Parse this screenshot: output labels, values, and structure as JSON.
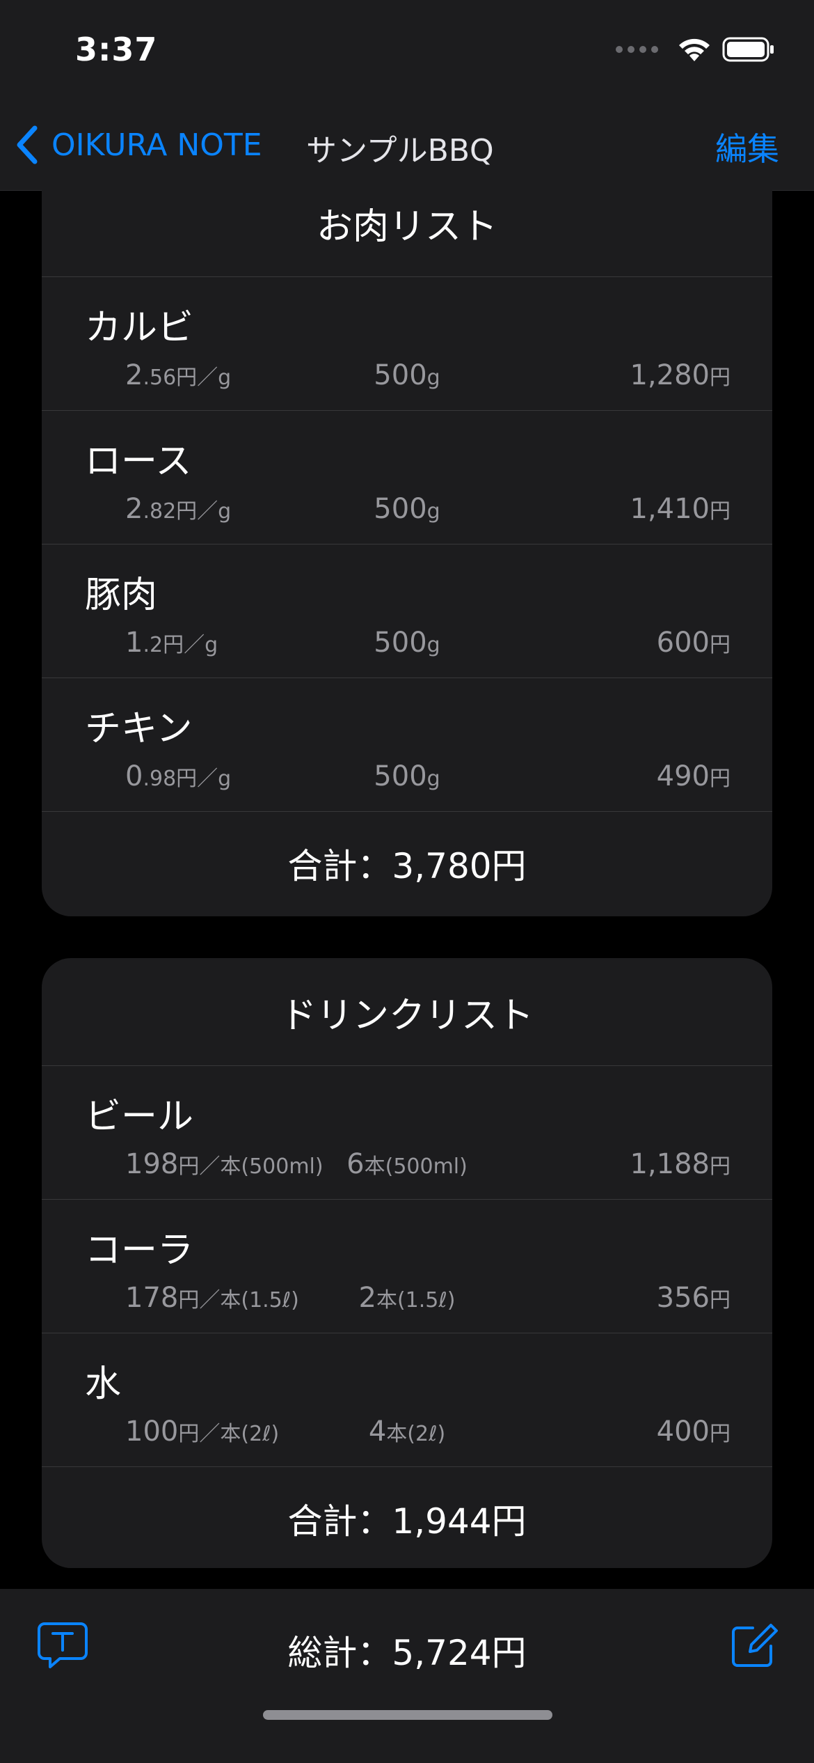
{
  "status": {
    "time": "3:37"
  },
  "nav": {
    "back_label": "OIKURA NOTE",
    "title": "サンプルBBQ",
    "edit_label": "編集"
  },
  "meat": {
    "title": "お肉リスト",
    "items": [
      {
        "name": "カルビ",
        "unit_main": "2",
        "unit_sub": ".56円／g",
        "qty_main": "500",
        "qty_sub": "g",
        "price_main": "1,280",
        "price_sub": "円"
      },
      {
        "name": "ロース",
        "unit_main": "2",
        "unit_sub": ".82円／g",
        "qty_main": "500",
        "qty_sub": "g",
        "price_main": "1,410",
        "price_sub": "円"
      },
      {
        "name": "豚肉",
        "unit_main": "1",
        "unit_sub": ".2円／g",
        "qty_main": "500",
        "qty_sub": "g",
        "price_main": "600",
        "price_sub": "円"
      },
      {
        "name": "チキン",
        "unit_main": "0",
        "unit_sub": ".98円／g",
        "qty_main": "500",
        "qty_sub": "g",
        "price_main": "490",
        "price_sub": "円"
      }
    ],
    "total": "合計：3,780円"
  },
  "drink": {
    "title": "ドリンクリスト",
    "items": [
      {
        "name": "ビール",
        "unit_main": "198",
        "unit_sub": "円／本(500ml)",
        "qty_main": "6",
        "qty_sub": "本(500ml)",
        "price_main": "1,188",
        "price_sub": "円"
      },
      {
        "name": "コーラ",
        "unit_main": "178",
        "unit_sub": "円／本(1.5ℓ)",
        "qty_main": "2",
        "qty_sub": "本(1.5ℓ)",
        "price_main": "356",
        "price_sub": "円"
      },
      {
        "name": "水",
        "unit_main": "100",
        "unit_sub": "円／本(2ℓ)",
        "qty_main": "4",
        "qty_sub": "本(2ℓ)",
        "price_main": "400",
        "price_sub": "円"
      }
    ],
    "total": "合計：1,944円"
  },
  "footer": {
    "grand_total": "総計：5,724円"
  },
  "colors": {
    "accent": "#0a84ff",
    "card": "#1c1c1e",
    "secondary_text": "#98989d"
  }
}
